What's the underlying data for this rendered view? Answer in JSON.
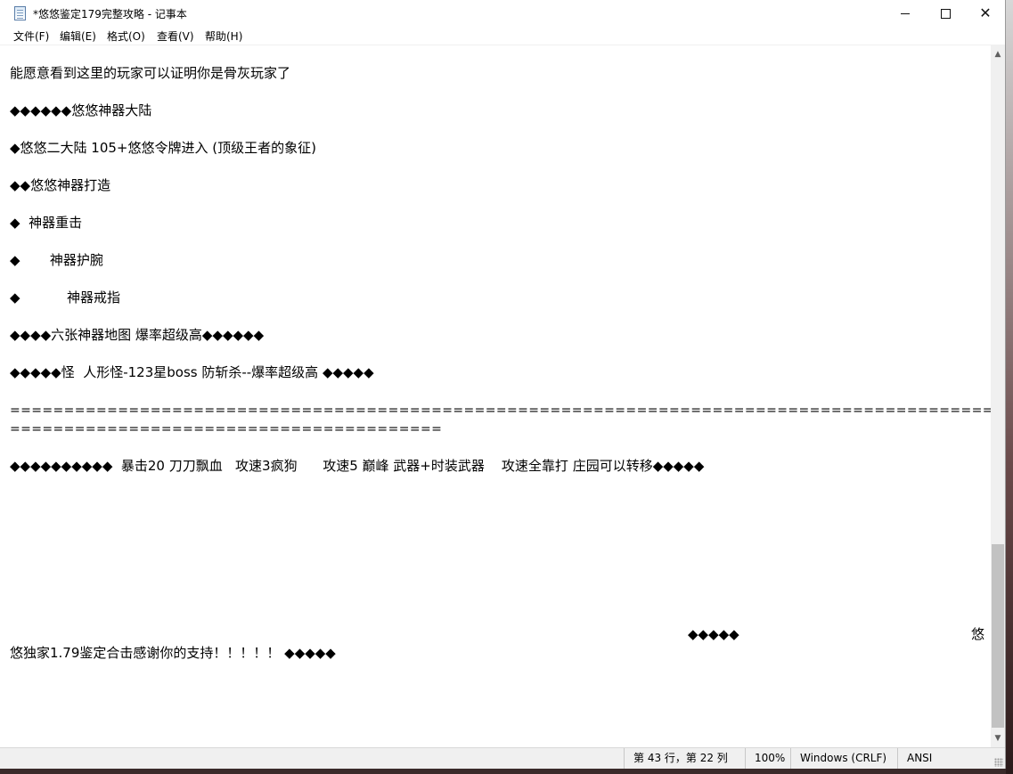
{
  "window": {
    "title": "*悠悠鉴定179完整攻略 - 记事本"
  },
  "icons": {
    "app": "notepad-icon",
    "minimize": "minimize-icon",
    "maximize": "maximize-icon",
    "close": "close-icon"
  },
  "menu": [
    {
      "label": "文件(F)"
    },
    {
      "label": "编辑(E)"
    },
    {
      "label": "格式(O)"
    },
    {
      "label": "查看(V)"
    },
    {
      "label": "帮助(H)"
    }
  ],
  "content": {
    "lines": [
      "能愿意看到这里的玩家可以证明你是骨灰玩家了",
      "◆◆◆◆◆◆悠悠神器大陆",
      "◆悠悠二大陆 105+悠悠令牌进入 (顶级王者的象征)",
      "◆◆悠悠神器打造",
      "◆  神器重击",
      "◆       神器护腕",
      "◆           神器戒指",
      "◆◆◆◆六张神器地图 爆率超级高◆◆◆◆◆◆",
      "◆◆◆◆◆怪  人形怪-123星boss 防斩杀--爆率超级高 ◆◆◆◆◆",
      "====================================================================================================",
      "========================================",
      "◆◆◆◆◆◆◆◆◆◆  暴击20 刀刀飘血   攻速3疯狗      攻速5 巅峰 武器+时装武器    攻速全靠打 庄园可以转移◆◆◆◆◆",
      "◆◆◆◆◆",
      "悠",
      "悠独家1.79鉴定合击感谢你的支持！！！！！ ◆◆◆◆◆"
    ]
  },
  "status": {
    "position": "第 43 行，第 22 列",
    "zoom": "100%",
    "line_ending": "Windows (CRLF)",
    "encoding": "ANSI"
  }
}
